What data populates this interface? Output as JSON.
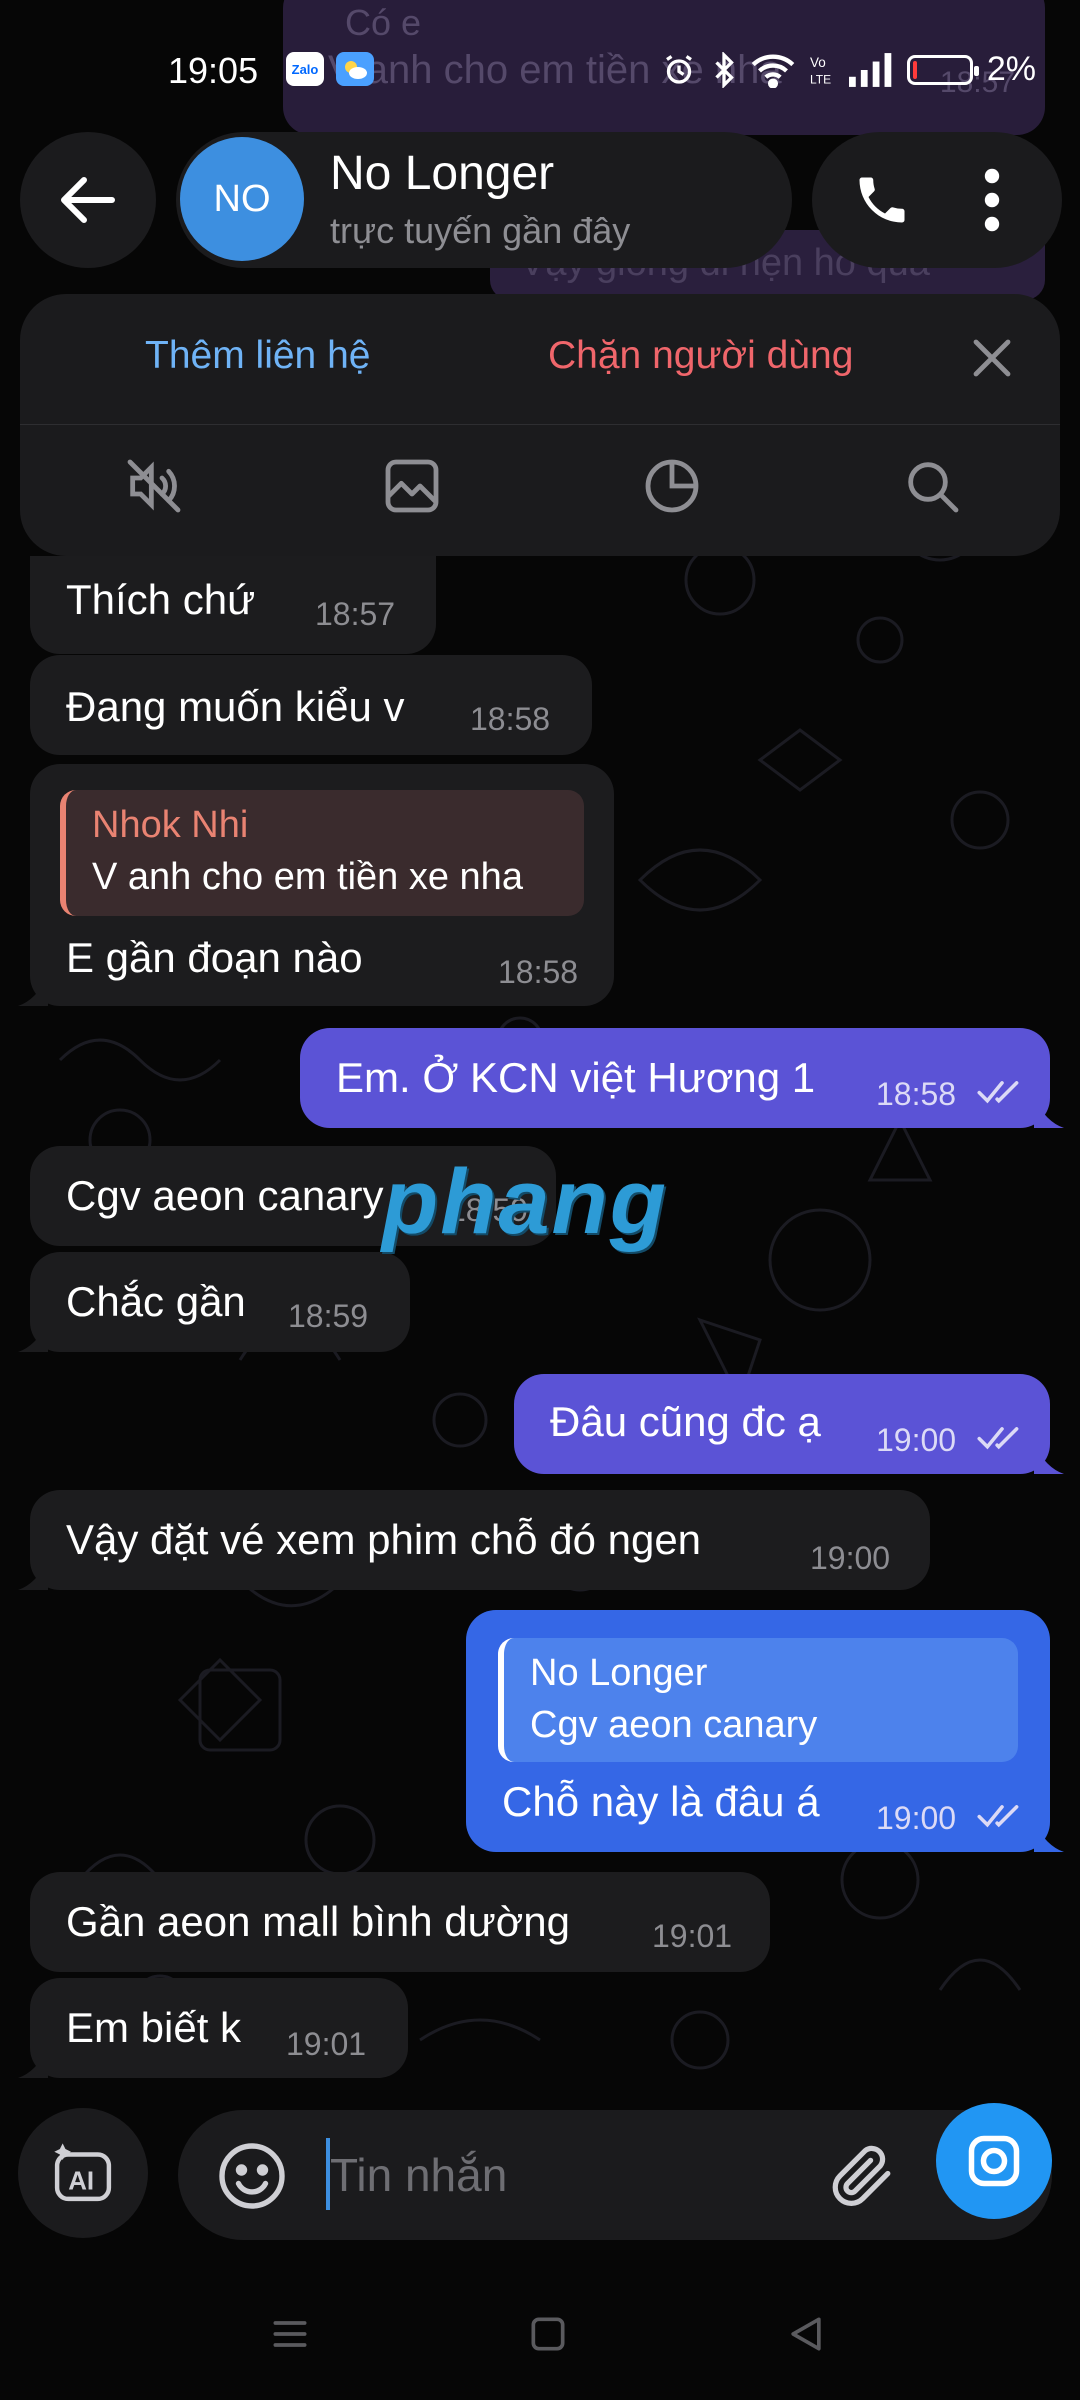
{
  "status_bar": {
    "time": "19:05",
    "zalo_label": "Zalo",
    "battery": "2%"
  },
  "ghost": {
    "line1": "Có e",
    "line2": "V anh cho em tiền xe nha",
    "time": "18:57",
    "line3": "Vậy giống đi hẹn hò quá"
  },
  "header": {
    "avatar_initials": "NO",
    "name": "No Longer",
    "status": "trực tuyến gần đây"
  },
  "action_panel": {
    "add_contact": "Thêm liên hệ",
    "block_user": "Chặn người dùng"
  },
  "messages": [
    {
      "dir": "in",
      "text": "Thích chứ",
      "time": "18:57"
    },
    {
      "dir": "in",
      "text": "Đang muốn kiểu v",
      "time": "18:58"
    },
    {
      "dir": "in",
      "reply_name": "Nhok Nhi",
      "reply_text": "V anh cho em tiền xe nha",
      "text": "E gần đoạn nào",
      "time": "18:58"
    },
    {
      "dir": "out",
      "text": "Em. Ở KCN việt Hương 1",
      "time": "18:58"
    },
    {
      "dir": "in",
      "text": "Cgv aeon canary",
      "time": "18:59"
    },
    {
      "dir": "in",
      "text": "Chắc gần",
      "time": "18:59"
    },
    {
      "dir": "out",
      "text": "Đâu cũng đc ạ",
      "time": "19:00"
    },
    {
      "dir": "in",
      "text": "Vậy đặt vé xem phim chỗ đó ngen",
      "time": "19:00"
    },
    {
      "dir": "out",
      "reply_name": "No Longer",
      "reply_text": "Cgv aeon canary",
      "text": "Chỗ này là đâu á",
      "time": "19:00"
    },
    {
      "dir": "in",
      "text": "Gần aeon mall bình dường",
      "time": "19:01"
    },
    {
      "dir": "in",
      "text": "Em biết k",
      "time": "19:01"
    }
  ],
  "watermark": "phang",
  "input": {
    "placeholder": "Tin nhắn"
  },
  "colors": {
    "background": "#060606",
    "incoming_bubble": "#1c1c1e",
    "outgoing_bubble": "#5b53d6",
    "outgoing_reply_bubble": "#3567e6",
    "accent_blue": "#6fb3f6",
    "danger_red": "#f0666b",
    "avatar": "#3d8fe0",
    "camera_button": "#2196f3"
  },
  "icons": [
    "back-arrow-icon",
    "phone-icon",
    "more-vert-icon",
    "close-icon",
    "mute-icon",
    "media-icon",
    "history-icon",
    "search-icon",
    "ai-sparkle-icon",
    "emoji-icon",
    "attach-icon",
    "camera-icon",
    "nav-menu-icon",
    "nav-home-icon",
    "nav-back-icon"
  ]
}
